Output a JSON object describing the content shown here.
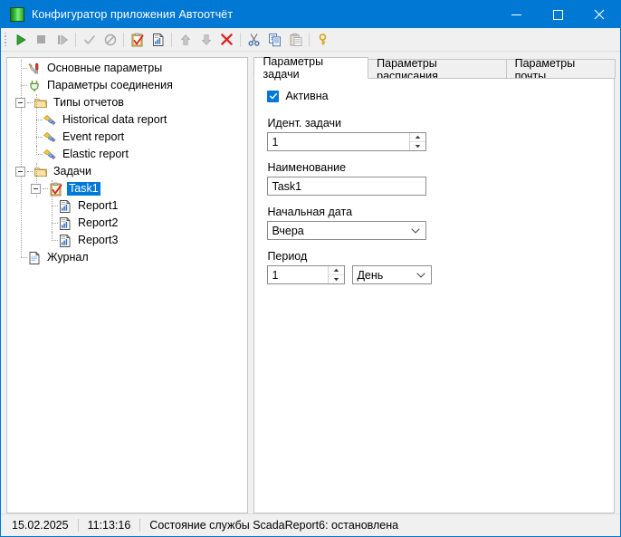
{
  "window": {
    "title": "Конфигуратор приложения Автоотчёт",
    "icon": "green-app-icon",
    "controls": {
      "minimize": "minimize-icon",
      "maximize": "maximize-icon",
      "close": "close-icon"
    },
    "accent_color": "#0078d4"
  },
  "toolbar": {
    "buttons": [
      {
        "name": "start-button",
        "icon": "play-icon",
        "enabled": true
      },
      {
        "name": "stop-button",
        "icon": "stop-square-icon",
        "enabled": false
      },
      {
        "name": "step-button",
        "icon": "step-icon",
        "enabled": false
      },
      {
        "name": "apply-button",
        "icon": "checkmark-icon",
        "enabled": false
      },
      {
        "name": "cancel-button",
        "icon": "forbidden-icon",
        "enabled": false
      },
      {
        "name": "add-task-button",
        "icon": "clipboard-check-icon",
        "enabled": true
      },
      {
        "name": "add-report-button",
        "icon": "report-document-icon",
        "enabled": true
      },
      {
        "name": "move-up-button",
        "icon": "arrow-up-icon",
        "enabled": false
      },
      {
        "name": "move-down-button",
        "icon": "arrow-down-icon",
        "enabled": false
      },
      {
        "name": "delete-button",
        "icon": "red-cross-icon",
        "enabled": true
      },
      {
        "name": "cut-button",
        "icon": "scissors-icon",
        "enabled": true
      },
      {
        "name": "copy-button",
        "icon": "copy-icon",
        "enabled": true
      },
      {
        "name": "paste-button",
        "icon": "paste-icon",
        "enabled": false
      },
      {
        "name": "key-button",
        "icon": "key-icon",
        "enabled": true
      }
    ]
  },
  "tree": {
    "nodes": [
      {
        "label": "Основные параметры",
        "icon": "tools-icon",
        "level": 1,
        "expander": "none",
        "selected": false
      },
      {
        "label": "Параметры соединения",
        "icon": "plug-icon",
        "level": 1,
        "expander": "none",
        "selected": false
      },
      {
        "label": "Типы отчетов",
        "icon": "folder-icon",
        "level": 1,
        "expander": "minus",
        "selected": false
      },
      {
        "label": "Historical data report",
        "icon": "gem-icon",
        "level": 2,
        "expander": "none",
        "selected": false
      },
      {
        "label": "Event report",
        "icon": "gem-icon",
        "level": 2,
        "expander": "none",
        "selected": false
      },
      {
        "label": "Elastic report",
        "icon": "gem-icon",
        "level": 2,
        "expander": "none",
        "selected": false
      },
      {
        "label": "Задачи",
        "icon": "folder-icon",
        "level": 1,
        "expander": "minus",
        "selected": false
      },
      {
        "label": "Task1",
        "icon": "clipboard-check-icon",
        "level": 2,
        "expander": "minus",
        "selected": true
      },
      {
        "label": "Report1",
        "icon": "report-document-icon",
        "level": 3,
        "expander": "none",
        "selected": false
      },
      {
        "label": "Report2",
        "icon": "report-document-icon",
        "level": 3,
        "expander": "none",
        "selected": false
      },
      {
        "label": "Report3",
        "icon": "report-document-icon",
        "level": 3,
        "expander": "none",
        "selected": false
      },
      {
        "label": "Журнал",
        "icon": "log-document-icon",
        "level": 1,
        "expander": "none",
        "selected": false
      }
    ]
  },
  "tabs": [
    {
      "label": "Параметры задачи",
      "active": true
    },
    {
      "label": "Параметры расписания",
      "active": false
    },
    {
      "label": "Параметры почты",
      "active": false
    }
  ],
  "form": {
    "active_checkbox": {
      "label": "Активна",
      "checked": true
    },
    "task_id": {
      "label": "Идент. задачи",
      "value": "1"
    },
    "name": {
      "label": "Наименование",
      "value": "Task1"
    },
    "start_date": {
      "label": "Начальная дата",
      "value": "Вчера"
    },
    "period": {
      "label": "Период",
      "value": "1",
      "unit": "День"
    }
  },
  "statusbar": {
    "date": "15.02.2025",
    "time": "11:13:16",
    "message": "Состояние службы ScadaReport6: остановлена"
  }
}
